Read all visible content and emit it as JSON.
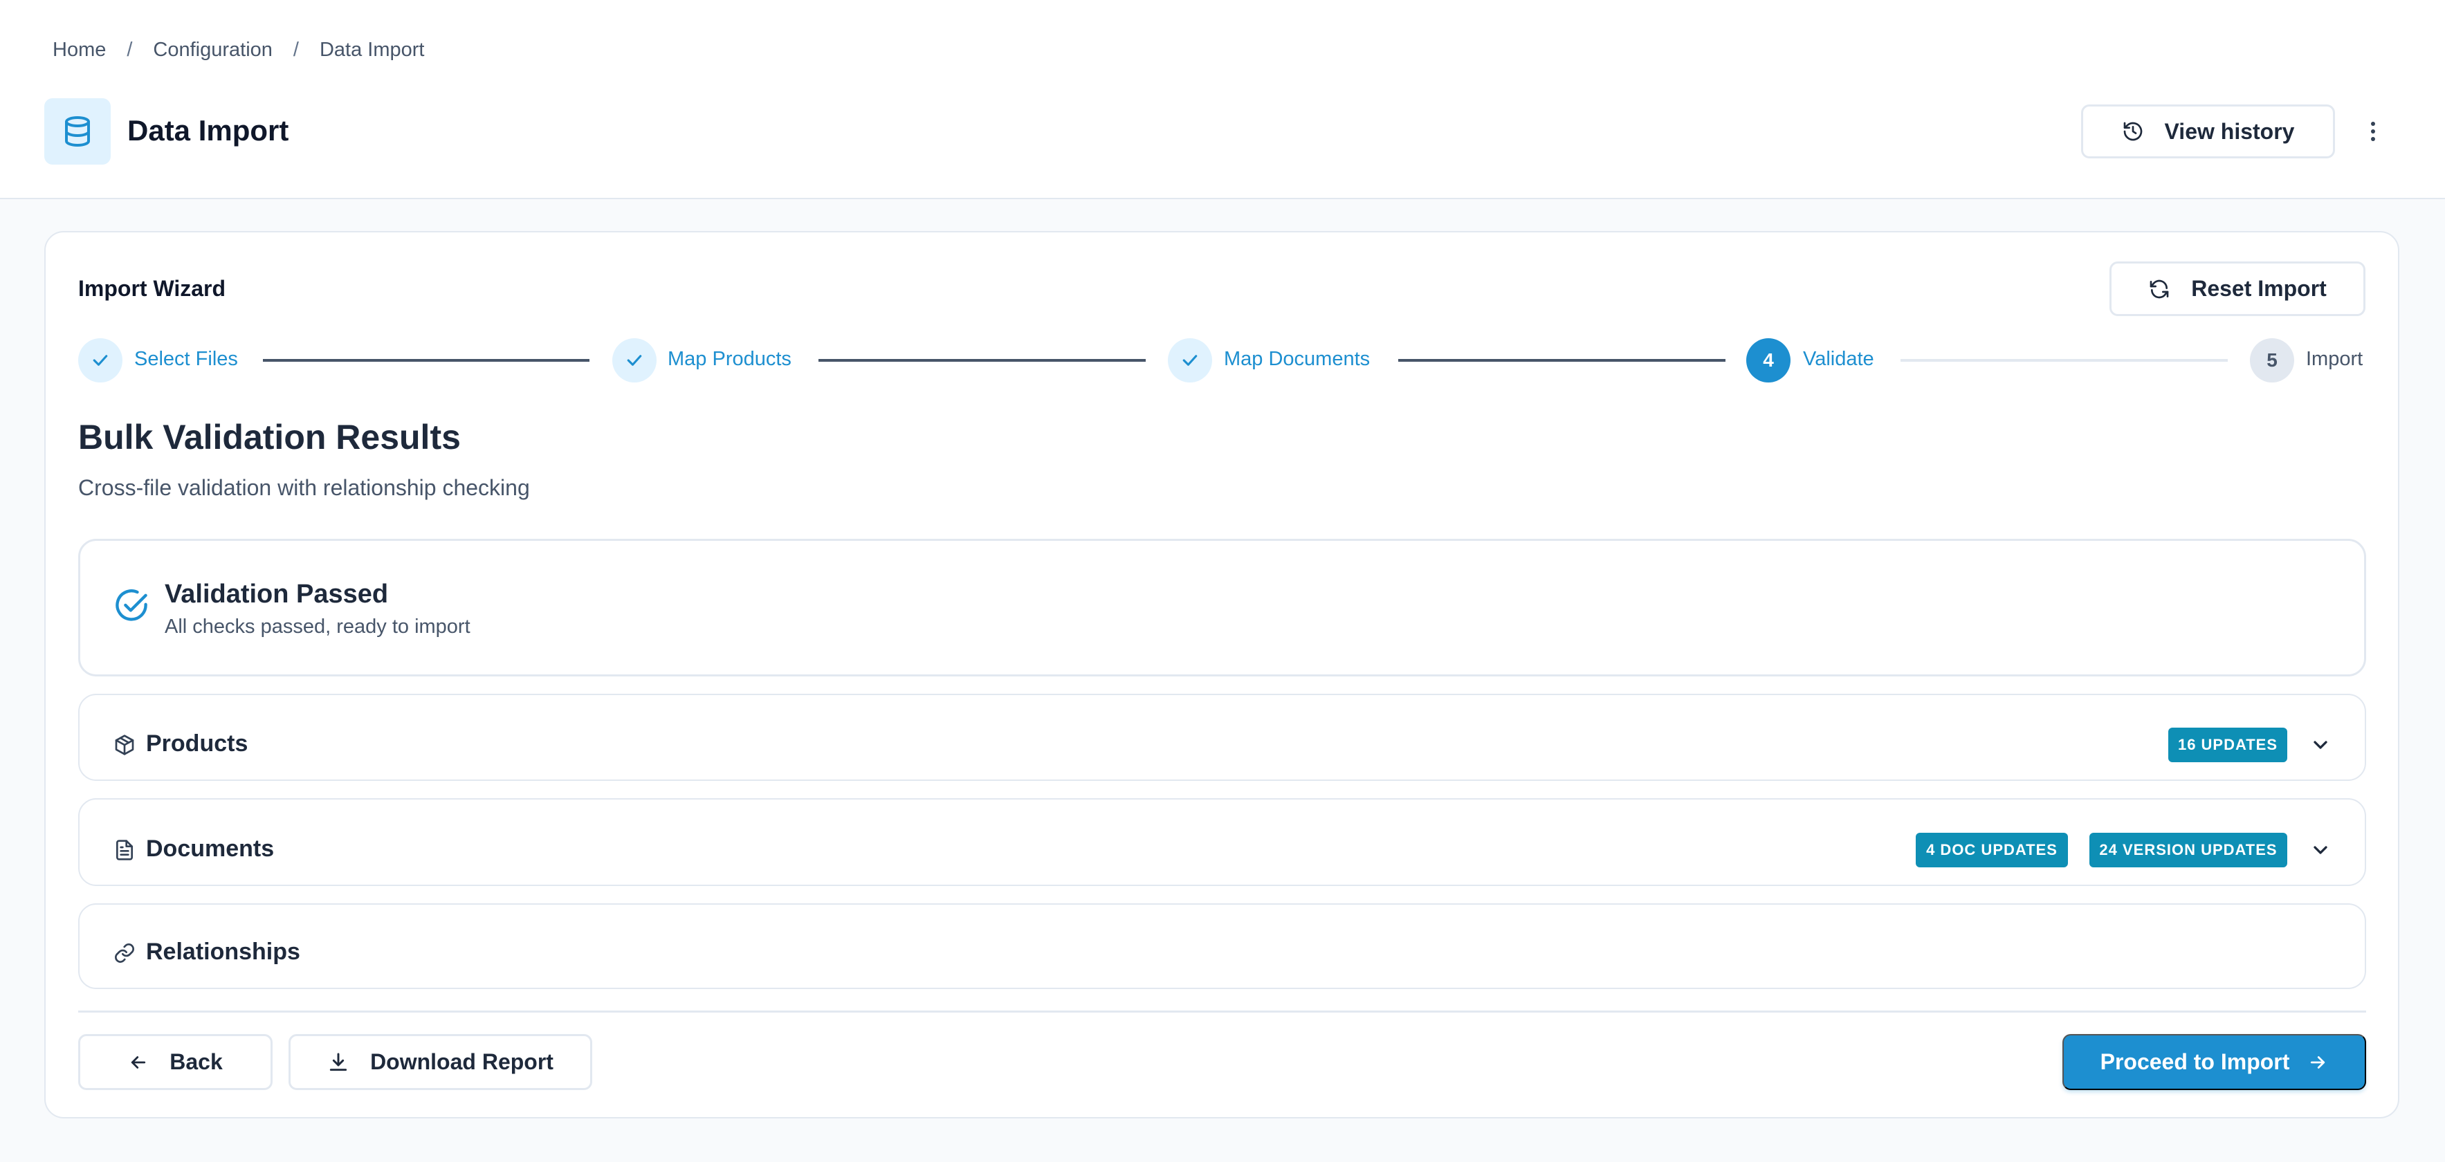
{
  "breadcrumb": {
    "home": "Home",
    "configuration": "Configuration",
    "current": "Data Import",
    "separator": "/"
  },
  "header": {
    "title": "Data Import",
    "icon": "database-icon",
    "view_history_label": "View history",
    "more_icon": "more-vertical-icon"
  },
  "wizard": {
    "title": "Import Wizard",
    "reset_label": "Reset Import",
    "steps": [
      {
        "number": "1",
        "label": "Select Files",
        "state": "done"
      },
      {
        "number": "2",
        "label": "Map Products",
        "state": "done"
      },
      {
        "number": "3",
        "label": "Map Documents",
        "state": "done"
      },
      {
        "number": "4",
        "label": "Validate",
        "state": "active"
      },
      {
        "number": "5",
        "label": "Import",
        "state": "pending"
      }
    ]
  },
  "results": {
    "title": "Bulk Validation Results",
    "subtitle": "Cross-file validation with relationship checking",
    "validation": {
      "title": "Validation Passed",
      "subtitle": "All checks passed, ready to import"
    },
    "products": {
      "label": "Products",
      "badge": "16 UPDATES"
    },
    "documents": {
      "label": "Documents",
      "badge_doc": "4 DOC UPDATES",
      "badge_version": "24 VERSION UPDATES"
    },
    "relationships": {
      "label": "Relationships"
    }
  },
  "footer": {
    "back_label": "Back",
    "download_label": "Download Report",
    "proceed_label": "Proceed to Import"
  },
  "colors": {
    "accent": "#1d8fd0",
    "badge": "#0e8fb5",
    "border": "#e2e8f0",
    "text": "#1e293b"
  }
}
